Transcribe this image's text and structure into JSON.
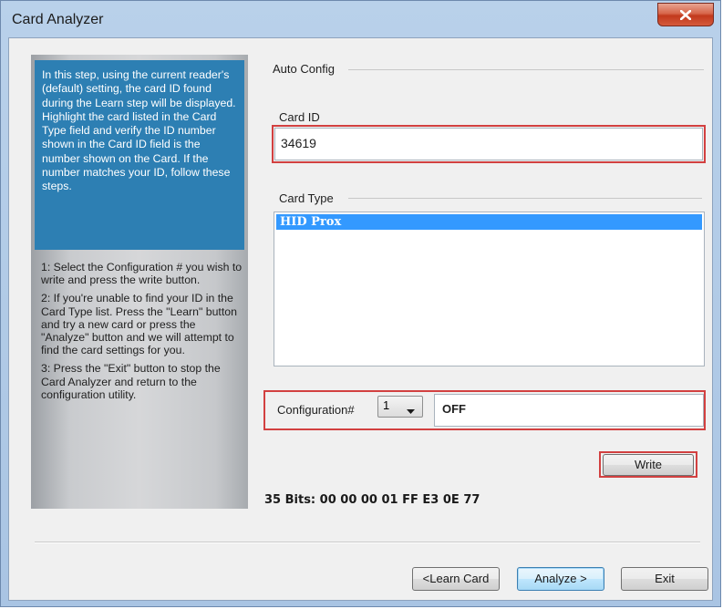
{
  "window": {
    "title": "Card Analyzer",
    "close_icon": "close-x-icon",
    "title_bar_color": "#b9d1ea",
    "close_button_color": "#c2391c"
  },
  "sidebar": {
    "instructions": "In this step, using the current reader's (default) setting, the card ID found during the Learn step will be displayed. Highlight the card listed in the Card Type field and verify the ID number shown in the Card ID field is the number shown on the Card. If the number matches your ID, follow these steps.",
    "steps": [
      "1: Select the Configuration # you wish to write and press the write button.",
      "2: If you're unable to find your ID in the Card Type list. Press the \"Learn\" button and try a new card or press the \"Analyze\" button and we will attempt to find the card settings for you.",
      "3: Press the \"Exit\" button to stop the Card Analyzer and return to the configuration utility."
    ],
    "panel_color": "#2d7fb3"
  },
  "auto_config": {
    "label": "Auto Config"
  },
  "card_id": {
    "label": "Card ID",
    "value": "34619"
  },
  "card_type": {
    "label": "Card Type",
    "items": [
      "HID Prox"
    ],
    "selected": "HID Prox"
  },
  "configuration": {
    "label": "Configuration#",
    "selected": "1",
    "chevron_icon": "chevron-down-icon",
    "status": "OFF"
  },
  "write_button": {
    "label": "Write"
  },
  "bits": {
    "text": "35 Bits: 00 00 00 01 FF E3 0E 77"
  },
  "footer": {
    "learn_label": "<Learn Card",
    "analyze_label": "Analyze >",
    "exit_label": "Exit"
  },
  "highlight_color": "#d24040",
  "selection_color": "#3399ff"
}
